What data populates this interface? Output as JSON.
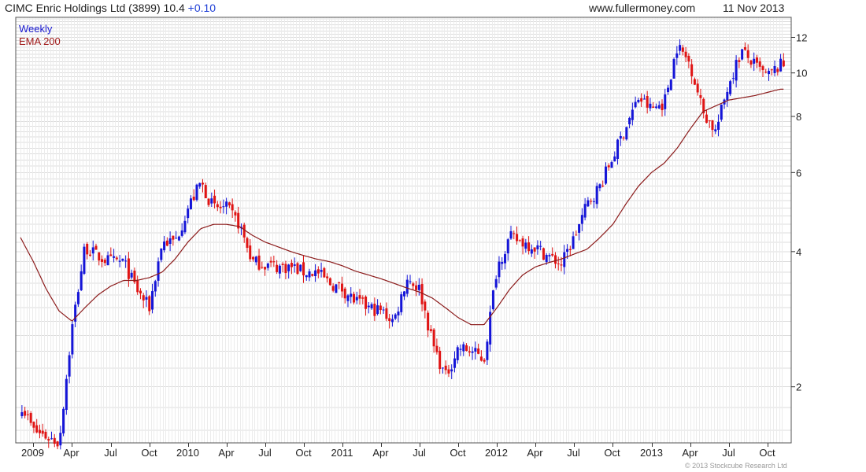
{
  "header": {
    "name": "CIMC Enric Holdings Ltd (3899)",
    "price": "10.4",
    "change": "+0.10",
    "site": "www.fullermoney.com",
    "date": "11 Nov 2013"
  },
  "copyright": "© 2013 Stockcube Research Ltd",
  "colors": {
    "up": "#1515d8",
    "down": "#e01414",
    "ema": "#8b1a1a",
    "grid": "#dcdcdc",
    "frame": "#555555"
  },
  "chart_data": {
    "type": "line",
    "legend": [
      "Weekly",
      "EMA 200"
    ],
    "legend_position": "top-left",
    "grid": true,
    "y_scale": "log",
    "ylim": [
      1.5,
      13.3
    ],
    "y_ticks": [
      2,
      4,
      6,
      8,
      10,
      12
    ],
    "x_ticks": [
      "2009",
      "Apr",
      "Jul",
      "Oct",
      "2010",
      "Apr",
      "Jul",
      "Oct",
      "2011",
      "Apr",
      "Jul",
      "Oct",
      "2012",
      "Apr",
      "Jul",
      "Oct",
      "2013",
      "Apr",
      "Jul",
      "Oct"
    ],
    "series": [
      {
        "name": "Weekly",
        "style": "candlestick",
        "x": [
          "2008-12",
          "2009-01",
          "2009-02",
          "2009-03",
          "2009-04",
          "2009-05",
          "2009-06",
          "2009-07",
          "2009-08",
          "2009-09",
          "2009-10",
          "2009-11",
          "2009-12",
          "2010-01",
          "2010-02",
          "2010-03",
          "2010-04",
          "2010-05",
          "2010-06",
          "2010-07",
          "2010-08",
          "2010-09",
          "2010-10",
          "2010-11",
          "2010-12",
          "2011-01",
          "2011-02",
          "2011-03",
          "2011-04",
          "2011-05",
          "2011-06",
          "2011-07",
          "2011-08",
          "2011-09",
          "2011-10",
          "2011-11",
          "2011-12",
          "2012-01",
          "2012-02",
          "2012-03",
          "2012-04",
          "2012-05",
          "2012-06",
          "2012-07",
          "2012-08",
          "2012-09",
          "2012-10",
          "2012-11",
          "2012-12",
          "2013-01",
          "2013-02",
          "2013-03",
          "2013-04",
          "2013-05",
          "2013-06",
          "2013-07",
          "2013-08",
          "2013-09",
          "2013-10",
          "2013-11"
        ],
        "values": [
          1.85,
          1.6,
          1.55,
          1.5,
          2.7,
          4.1,
          3.9,
          3.8,
          3.8,
          3.3,
          3.0,
          4.2,
          4.2,
          5.0,
          5.7,
          5.0,
          5.0,
          4.6,
          3.8,
          3.75,
          3.7,
          3.7,
          3.6,
          3.6,
          3.4,
          3.3,
          3.1,
          3.0,
          2.95,
          2.8,
          3.5,
          3.3,
          2.5,
          2.1,
          2.45,
          2.4,
          2.3,
          3.7,
          4.3,
          4.2,
          4.1,
          3.9,
          3.75,
          4.3,
          5.1,
          5.6,
          6.5,
          7.6,
          8.8,
          8.3,
          8.6,
          11.5,
          10.5,
          8.2,
          7.4,
          9.5,
          11.2,
          10.4,
          9.8,
          10.4
        ]
      },
      {
        "name": "EMA 200",
        "style": "line",
        "x": [
          "2008-12",
          "2009-01",
          "2009-02",
          "2009-03",
          "2009-04",
          "2009-05",
          "2009-06",
          "2009-07",
          "2009-08",
          "2009-09",
          "2009-10",
          "2009-11",
          "2009-12",
          "2010-01",
          "2010-02",
          "2010-03",
          "2010-04",
          "2010-05",
          "2010-06",
          "2010-07",
          "2010-08",
          "2010-09",
          "2010-10",
          "2010-11",
          "2010-12",
          "2011-01",
          "2011-02",
          "2011-03",
          "2011-04",
          "2011-05",
          "2011-06",
          "2011-07",
          "2011-08",
          "2011-09",
          "2011-10",
          "2011-11",
          "2011-12",
          "2012-01",
          "2012-02",
          "2012-03",
          "2012-04",
          "2012-05",
          "2012-06",
          "2012-07",
          "2012-08",
          "2012-09",
          "2012-10",
          "2012-11",
          "2012-12",
          "2013-01",
          "2013-02",
          "2013-03",
          "2013-04",
          "2013-05",
          "2013-06",
          "2013-07",
          "2013-08",
          "2013-09",
          "2013-10",
          "2013-11"
        ],
        "values": [
          4.3,
          3.8,
          3.3,
          2.95,
          2.8,
          3.0,
          3.2,
          3.35,
          3.45,
          3.45,
          3.5,
          3.6,
          3.85,
          4.2,
          4.5,
          4.6,
          4.6,
          4.55,
          4.35,
          4.2,
          4.1,
          4.0,
          3.92,
          3.85,
          3.8,
          3.72,
          3.62,
          3.55,
          3.48,
          3.4,
          3.32,
          3.25,
          3.15,
          3.0,
          2.85,
          2.75,
          2.75,
          3.0,
          3.3,
          3.55,
          3.7,
          3.78,
          3.85,
          3.95,
          4.05,
          4.3,
          4.6,
          5.1,
          5.6,
          6.0,
          6.3,
          6.8,
          7.5,
          8.2,
          8.45,
          8.7,
          8.8,
          8.9,
          9.05,
          9.2
        ]
      }
    ]
  }
}
